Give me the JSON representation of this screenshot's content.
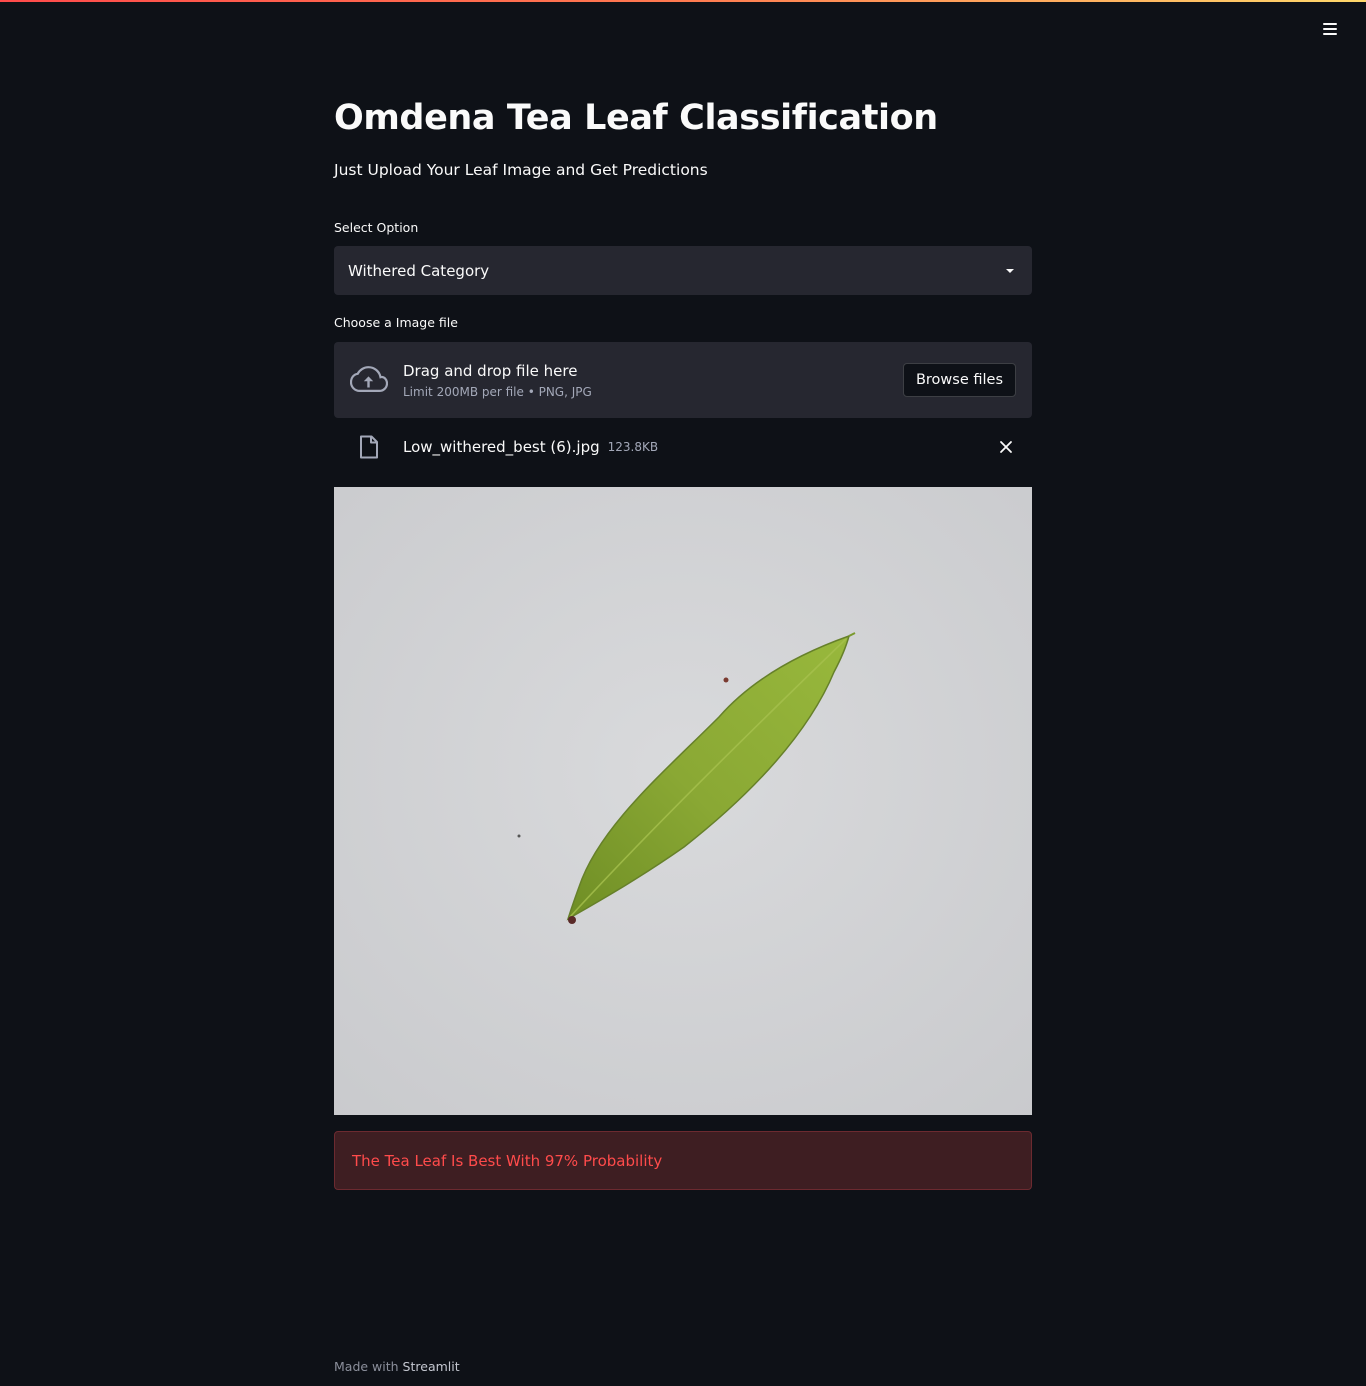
{
  "app": {
    "title": "Omdena Tea Leaf Classification",
    "subtitle": "Just Upload Your Leaf Image and Get Predictions"
  },
  "header": {
    "menu_icon": "hamburger-menu-icon"
  },
  "select_option": {
    "label": "Select Option",
    "value": "Withered Category",
    "caret_icon": "caret-down-icon"
  },
  "uploader": {
    "label": "Choose a Image file",
    "dropzone_title": "Drag and drop file here",
    "dropzone_limit": "Limit 200MB per file • PNG, JPG",
    "browse_label": "Browse files",
    "upload_icon": "cloud-upload-icon"
  },
  "uploaded_file": {
    "name": "Low_withered_best (6).jpg",
    "size": "123.8KB",
    "file_icon": "file-icon",
    "remove_icon": "close-icon"
  },
  "result": {
    "message": "The Tea Leaf Is Best With 97% Probability"
  },
  "footer": {
    "prefix": "Made with ",
    "link": "Streamlit"
  },
  "colors": {
    "background": "#0e1117",
    "widget_bg": "#262730",
    "error_bg": "#3e1e22",
    "error_text": "#ff4b4b",
    "text": "#fafafa",
    "muted_text": "#a3a8b8"
  }
}
